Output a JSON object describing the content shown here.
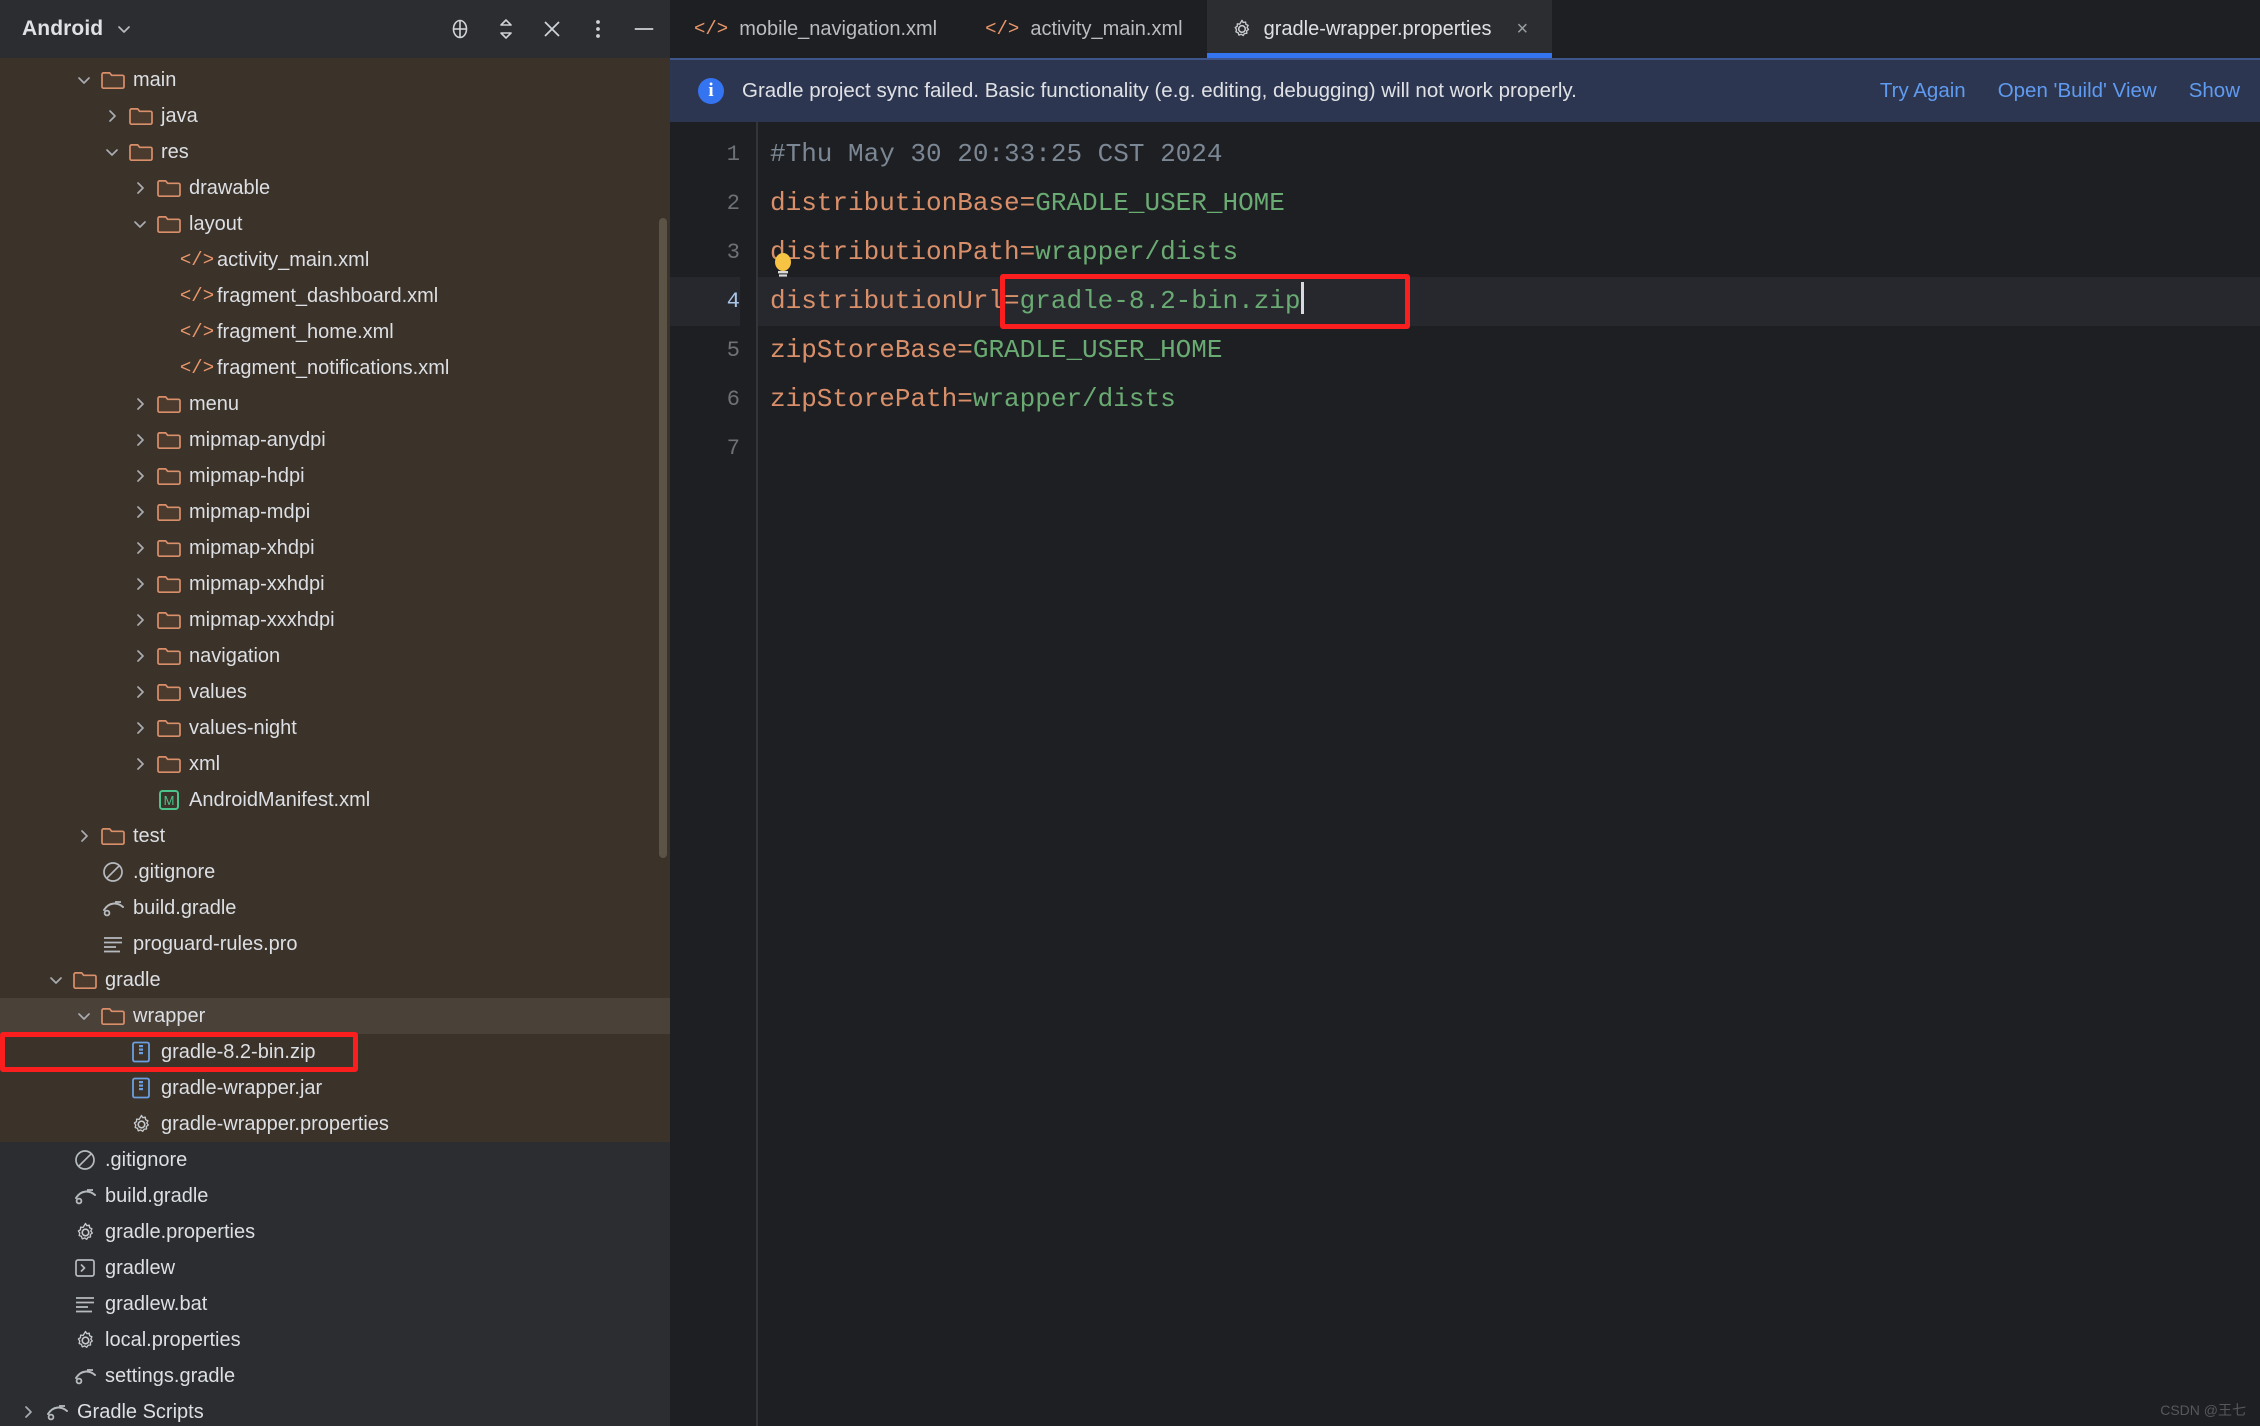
{
  "project_panel": {
    "title": "Android",
    "chevron_icon": "chevron-down-icon",
    "actions": [
      {
        "name": "select-opened-file-icon",
        "label": "target-icon"
      },
      {
        "name": "expand-collapse-icon",
        "label": "sort-icon"
      },
      {
        "name": "collapse-all-icon",
        "label": "x-icon"
      },
      {
        "name": "more-options-icon",
        "label": "vertical-ellipsis-icon"
      },
      {
        "name": "hide-panel-icon",
        "label": "minus-icon"
      }
    ]
  },
  "tabs": [
    {
      "label": "mobile_navigation.xml",
      "icon": "xml-tag-icon",
      "active": false,
      "closable": false
    },
    {
      "label": "activity_main.xml",
      "icon": "xml-tag-icon",
      "active": false,
      "closable": false
    },
    {
      "label": "gradle-wrapper.properties",
      "icon": "gear-icon",
      "active": true,
      "closable": true,
      "close_label": "×"
    }
  ],
  "notification": {
    "icon": "info-icon",
    "icon_glyph": "i",
    "message": "Gradle project sync failed. Basic functionality (e.g. editing, debugging) will not work properly.",
    "actions": [
      "Try Again",
      "Open 'Build' View",
      "Show"
    ]
  },
  "editor": {
    "filename": "gradle-wrapper.properties",
    "gutter_lines": [
      "1",
      "2",
      "3",
      "4",
      "5",
      "6",
      "7"
    ],
    "current_line": 4,
    "lines": [
      {
        "n": 1,
        "type": "comment",
        "text": "#Thu May 30 20:33:25 CST 2024"
      },
      {
        "n": 2,
        "type": "kv",
        "key": "distributionBase",
        "eq": "=",
        "value": "GRADLE_USER_HOME"
      },
      {
        "n": 3,
        "type": "kv",
        "key": "distributionPath",
        "eq": "=",
        "value": "wrapper/dists"
      },
      {
        "n": 4,
        "type": "kv",
        "key": "distributionUrl",
        "eq": "=",
        "value": "gradle-8.2-bin.zip"
      },
      {
        "n": 5,
        "type": "kv",
        "key": "zipStoreBase",
        "eq": "=",
        "value": "GRADLE_USER_HOME"
      },
      {
        "n": 6,
        "type": "kv",
        "key": "zipStorePath",
        "eq": "=",
        "value": "wrapper/dists"
      },
      {
        "n": 7,
        "type": "empty",
        "text": ""
      }
    ],
    "intention_icon": "lightbulb-icon",
    "highlight_color": "#fa1e1e"
  },
  "tree": [
    {
      "label": "main",
      "icon": "folder-icon",
      "twisty": "down",
      "indent": 2
    },
    {
      "label": "java",
      "icon": "folder-icon",
      "twisty": "right",
      "indent": 3
    },
    {
      "label": "res",
      "icon": "folder-icon",
      "twisty": "down",
      "indent": 3
    },
    {
      "label": "drawable",
      "icon": "folder-icon",
      "twisty": "right",
      "indent": 4
    },
    {
      "label": "layout",
      "icon": "folder-icon",
      "twisty": "down",
      "indent": 4
    },
    {
      "label": "activity_main.xml",
      "icon": "xml-file-icon",
      "twisty": "none",
      "indent": 5
    },
    {
      "label": "fragment_dashboard.xml",
      "icon": "xml-file-icon",
      "twisty": "none",
      "indent": 5
    },
    {
      "label": "fragment_home.xml",
      "icon": "xml-file-icon",
      "twisty": "none",
      "indent": 5
    },
    {
      "label": "fragment_notifications.xml",
      "icon": "xml-file-icon",
      "twisty": "none",
      "indent": 5
    },
    {
      "label": "menu",
      "icon": "folder-icon",
      "twisty": "right",
      "indent": 4
    },
    {
      "label": "mipmap-anydpi",
      "icon": "folder-icon",
      "twisty": "right",
      "indent": 4
    },
    {
      "label": "mipmap-hdpi",
      "icon": "folder-icon",
      "twisty": "right",
      "indent": 4
    },
    {
      "label": "mipmap-mdpi",
      "icon": "folder-icon",
      "twisty": "right",
      "indent": 4
    },
    {
      "label": "mipmap-xhdpi",
      "icon": "folder-icon",
      "twisty": "right",
      "indent": 4
    },
    {
      "label": "mipmap-xxhdpi",
      "icon": "folder-icon",
      "twisty": "right",
      "indent": 4
    },
    {
      "label": "mipmap-xxxhdpi",
      "icon": "folder-icon",
      "twisty": "right",
      "indent": 4
    },
    {
      "label": "navigation",
      "icon": "folder-icon",
      "twisty": "right",
      "indent": 4
    },
    {
      "label": "values",
      "icon": "folder-icon",
      "twisty": "right",
      "indent": 4
    },
    {
      "label": "values-night",
      "icon": "folder-icon",
      "twisty": "right",
      "indent": 4
    },
    {
      "label": "xml",
      "icon": "folder-icon",
      "twisty": "right",
      "indent": 4
    },
    {
      "label": "AndroidManifest.xml",
      "icon": "manifest-icon",
      "twisty": "none",
      "indent": 4
    },
    {
      "label": "test",
      "icon": "folder-icon",
      "twisty": "right",
      "indent": 2
    },
    {
      "label": ".gitignore",
      "icon": "ignore-icon",
      "twisty": "none",
      "indent": 2
    },
    {
      "label": "build.gradle",
      "icon": "gradle-file-icon",
      "twisty": "none",
      "indent": 2
    },
    {
      "label": "proguard-rules.pro",
      "icon": "text-file-icon",
      "twisty": "none",
      "indent": 2
    },
    {
      "label": "gradle",
      "icon": "folder-icon",
      "twisty": "down",
      "indent": 1
    },
    {
      "label": "wrapper",
      "icon": "folder-icon",
      "twisty": "down",
      "indent": 2,
      "selected": true
    },
    {
      "label": "gradle-8.2-bin.zip",
      "icon": "archive-icon",
      "twisty": "none",
      "indent": 3,
      "highlighted": true
    },
    {
      "label": "gradle-wrapper.jar",
      "icon": "archive-icon",
      "twisty": "none",
      "indent": 3
    },
    {
      "label": "gradle-wrapper.properties",
      "icon": "gear-icon",
      "twisty": "none",
      "indent": 3
    },
    {
      "label": ".gitignore",
      "icon": "ignore-icon",
      "twisty": "none",
      "indent": 1,
      "dark": true
    },
    {
      "label": "build.gradle",
      "icon": "gradle-file-icon",
      "twisty": "none",
      "indent": 1,
      "dark": true
    },
    {
      "label": "gradle.properties",
      "icon": "gear-icon",
      "twisty": "none",
      "indent": 1,
      "dark": true
    },
    {
      "label": "gradlew",
      "icon": "script-icon",
      "twisty": "none",
      "indent": 1,
      "dark": true
    },
    {
      "label": "gradlew.bat",
      "icon": "text-file-icon",
      "twisty": "none",
      "indent": 1,
      "dark": true
    },
    {
      "label": "local.properties",
      "icon": "gear-icon",
      "twisty": "none",
      "indent": 1,
      "dark": true
    },
    {
      "label": "settings.gradle",
      "icon": "gradle-file-icon",
      "twisty": "none",
      "indent": 1,
      "dark": true
    },
    {
      "label": "Gradle Scripts",
      "icon": "gradle-file-icon",
      "twisty": "right",
      "indent": 0,
      "dark": true
    }
  ],
  "watermark": "CSDN @王七"
}
